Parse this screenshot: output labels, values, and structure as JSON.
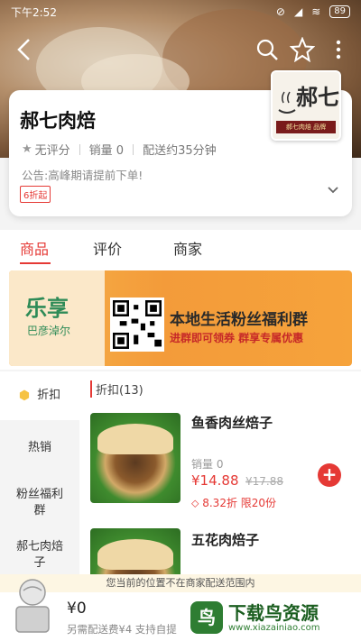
{
  "status_bar": {
    "time": "下午2:52",
    "battery": "89"
  },
  "store": {
    "name": "郝七肉焙",
    "rating": "无评分",
    "sales": "销量 0",
    "delivery": "配送约35分钟",
    "notice": "公告:高峰期请提前下单!",
    "discount_badge": "6折起",
    "logo_text": "郝七",
    "logo_bar": "郝七肉焙 品牌"
  },
  "tabs": [
    {
      "label": "商品"
    },
    {
      "label": "评价"
    },
    {
      "label": "商家"
    }
  ],
  "promo": {
    "logo_main": "乐享",
    "logo_sub": "巴彦淖尔",
    "title": "本地生活粉丝福利群",
    "subtitle": "进群即可领券 群享专属优惠"
  },
  "sidebar": {
    "items": [
      {
        "label": "折扣"
      },
      {
        "label": "热销"
      },
      {
        "label": "粉丝福利群"
      },
      {
        "label": "郝七肉焙子"
      }
    ]
  },
  "section": {
    "title": "折扣(13)"
  },
  "products": [
    {
      "name": "鱼香肉丝焙子",
      "sales": "销量 0",
      "price": "¥14.88",
      "old_price": "¥17.88",
      "discount": "8.32折 限20份"
    },
    {
      "name": "五花肉焙子"
    }
  ],
  "warning": "您当前的位置不在商家配送范围内",
  "cart": {
    "total": "¥0",
    "fee": "另需配送费¥4 支持自提"
  },
  "watermark": {
    "title": "下载鸟资源",
    "url": "www.xiazainiao.com",
    "icon": "鸟"
  },
  "colors": {
    "accent": "#e53935",
    "promo": "#f39b3a"
  }
}
